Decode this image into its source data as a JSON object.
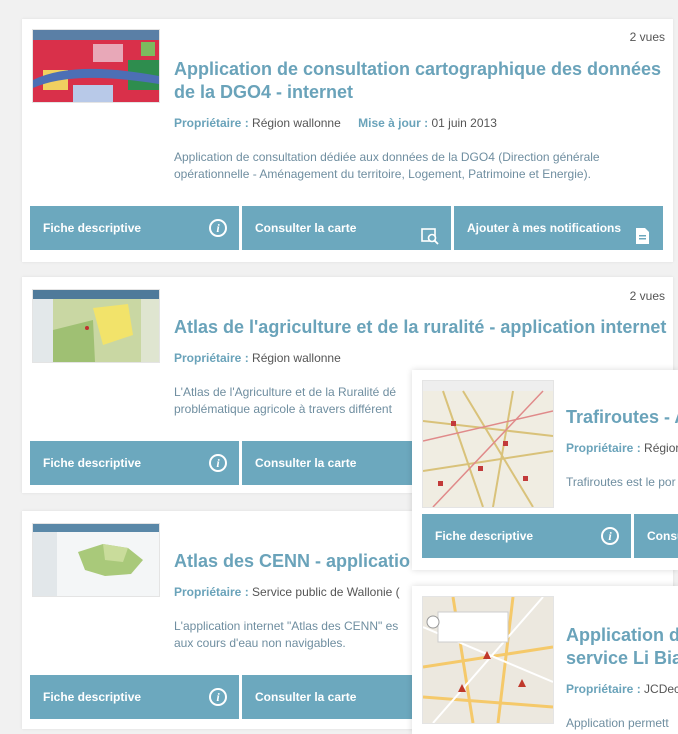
{
  "cards": [
    {
      "views": "2 vues",
      "title_line1": "Application de consultation cartographique des données",
      "title_line2": "de la DGO4 - internet",
      "owner_label": "Propriétaire :",
      "owner": "Région wallonne",
      "update_label": "Mise à jour :",
      "update": "01 juin 2013",
      "desc_line1": "Application de consultation dédiée aux données de la DGO4 (Direction générale",
      "desc_line2": "opérationnelle - Aménagement du territoire, Logement, Patrimoine et Energie).",
      "btn_fiche": "Fiche descriptive",
      "btn_carte": "Consulter la carte",
      "btn_notif": "Ajouter à mes notifications"
    },
    {
      "views": "2 vues",
      "title_line1": "Atlas de l'agriculture et de la ruralité - application internet",
      "owner_label": "Propriétaire :",
      "owner": "Région wallonne",
      "desc_line1": "L'Atlas de l'Agriculture et de la Ruralité dé",
      "desc_line2": "problématique agricole à travers différent",
      "btn_fiche": "Fiche descriptive",
      "btn_carte": "Consulter la carte"
    },
    {
      "title_line1": "Atlas des CENN - applicatio",
      "owner_label": "Propriétaire :",
      "owner": "Service public de Wallonie (",
      "desc_line1": "L'application internet \"Atlas des CENN\" es",
      "desc_line2": "aux cours d'eau non navigables.",
      "btn_fiche": "Fiche descriptive",
      "btn_carte": "Consulter la carte"
    },
    {
      "title_line1": "Trafiroutes - A",
      "owner_label": "Propriétaire :",
      "owner": "Régior",
      "desc_line1": "Trafiroutes est le por",
      "btn_fiche": "Fiche descriptive",
      "btn_carte": "Consu"
    },
    {
      "title_line1": "Application d",
      "title_line2": "service Li Bia",
      "owner_label": "Propriétaire :",
      "owner": "JCDec",
      "desc_line1": "Application permett"
    }
  ],
  "colors": {
    "accent": "#6aa3ba",
    "button": "#6ca8be"
  },
  "icons": [
    "info-icon",
    "map-search-icon",
    "notification-icon"
  ]
}
